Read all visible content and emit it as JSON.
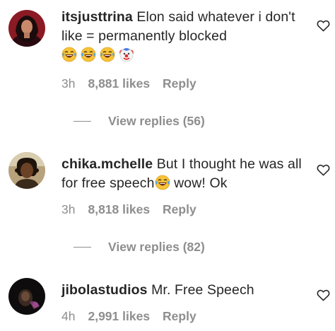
{
  "comments": [
    {
      "username": "itsjusttrina",
      "text": "Elon said whatever i don't like = permanently blocked",
      "emojis": [
        "laughing-crying-emoji",
        "laughing-crying-emoji",
        "laughing-crying-emoji",
        "clown-emoji"
      ],
      "timestamp": "3h",
      "likes": "8,881 likes",
      "reply": "Reply",
      "view_replies": "View replies (56)"
    },
    {
      "username": "chika.mchelle",
      "text_before_emoji": "But I thought he was all for free speech",
      "emoji": "laughing-crying-emoji",
      "text_after_emoji": " wow! Ok",
      "timestamp": "3h",
      "likes": "8,818 likes",
      "reply": "Reply",
      "view_replies": "View replies (82)"
    },
    {
      "username": "jibolastudios",
      "text": "Mr. Free Speech",
      "timestamp": "4h",
      "likes": "2,991 likes",
      "reply": "Reply"
    }
  ],
  "colors": {
    "text": "#262626",
    "secondary": "#8e8e8e",
    "background": "#ffffff"
  }
}
